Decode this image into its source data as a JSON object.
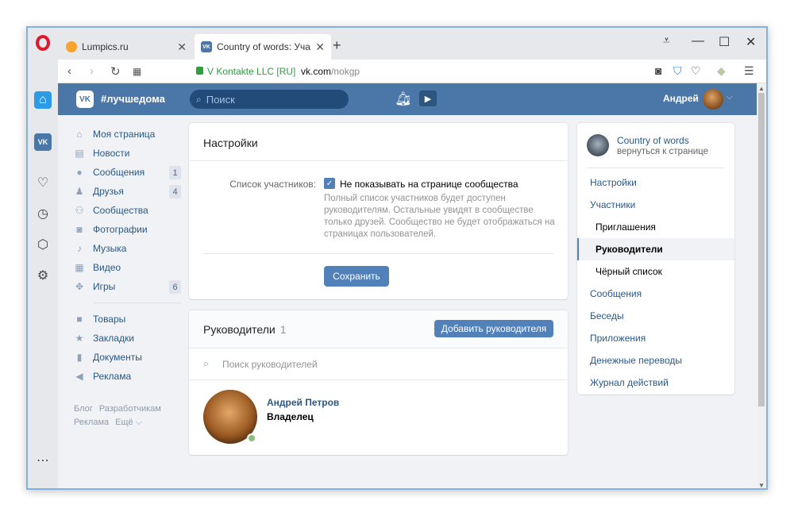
{
  "browser": {
    "tabs": [
      {
        "title": "Lumpics.ru",
        "active": false
      },
      {
        "title": "Country of words: Участни",
        "active": true
      }
    ],
    "new_tab": "+",
    "controls": {
      "menu": "⩡",
      "minimize": "—",
      "maximize": "☐",
      "close": "✕"
    },
    "address": {
      "secure_label": "V Kontakte LLC [RU]",
      "host": "vk.com",
      "path": "/nokgp"
    },
    "icons": [
      "camera-icon",
      "shield-check-icon",
      "heart-icon",
      "cube-icon",
      "settings-sliders-icon"
    ]
  },
  "vk_header": {
    "hashtag": "#лучшедома",
    "search_placeholder": "Поиск",
    "username": "Андрей",
    "accent": "#4a76a8"
  },
  "left_menu": {
    "items": [
      {
        "label": "Моя страница",
        "icon": "house-icon",
        "badge": ""
      },
      {
        "label": "Новости",
        "icon": "news-icon",
        "badge": ""
      },
      {
        "label": "Сообщения",
        "icon": "chat-icon",
        "badge": "1"
      },
      {
        "label": "Друзья",
        "icon": "person-icon",
        "badge": "4"
      },
      {
        "label": "Сообщества",
        "icon": "group-icon",
        "badge": ""
      },
      {
        "label": "Фотографии",
        "icon": "camera-icon",
        "badge": ""
      },
      {
        "label": "Музыка",
        "icon": "music-icon",
        "badge": ""
      },
      {
        "label": "Видео",
        "icon": "film-icon",
        "badge": ""
      },
      {
        "label": "Игры",
        "icon": "gamepad-icon",
        "badge": "6"
      }
    ],
    "items2": [
      {
        "label": "Товары",
        "icon": "bag-icon"
      },
      {
        "label": "Закладки",
        "icon": "star-icon"
      },
      {
        "label": "Документы",
        "icon": "document-icon"
      },
      {
        "label": "Реклама",
        "icon": "megaphone-icon"
      }
    ],
    "footer": {
      "blog": "Блог",
      "developers": "Разработчикам",
      "ads": "Реклама",
      "more": "Ещё ⌵"
    }
  },
  "settings": {
    "title": "Настройки",
    "field_label": "Список участников:",
    "checkbox_label": "Не показывать на странице сообщества",
    "checked": true,
    "help": "Полный список участников будет доступен руководителям. Остальные увидят в сообществе только друзей. Сообщество не будет отображаться на страницах пользователей.",
    "save": "Сохранить"
  },
  "managers": {
    "title": "Руководители",
    "count": "1",
    "add_button": "Добавить руководителя",
    "search_placeholder": "Поиск руководителей",
    "rows": [
      {
        "name": "Андрей Петров",
        "role": "Владелец",
        "online": true
      }
    ]
  },
  "right_menu": {
    "community_name": "Country of words",
    "back": "вернуться к странице",
    "items": [
      {
        "label": "Настройки",
        "sub": false,
        "selected": false
      },
      {
        "label": "Участники",
        "sub": false,
        "selected": false
      },
      {
        "label": "Приглашения",
        "sub": true,
        "selected": false
      },
      {
        "label": "Руководители",
        "sub": true,
        "selected": true
      },
      {
        "label": "Чёрный список",
        "sub": true,
        "selected": false
      },
      {
        "label": "Сообщения",
        "sub": false,
        "selected": false
      },
      {
        "label": "Беседы",
        "sub": false,
        "selected": false
      },
      {
        "label": "Приложения",
        "sub": false,
        "selected": false
      },
      {
        "label": "Денежные переводы",
        "sub": false,
        "selected": false
      },
      {
        "label": "Журнал действий",
        "sub": false,
        "selected": false
      }
    ]
  }
}
